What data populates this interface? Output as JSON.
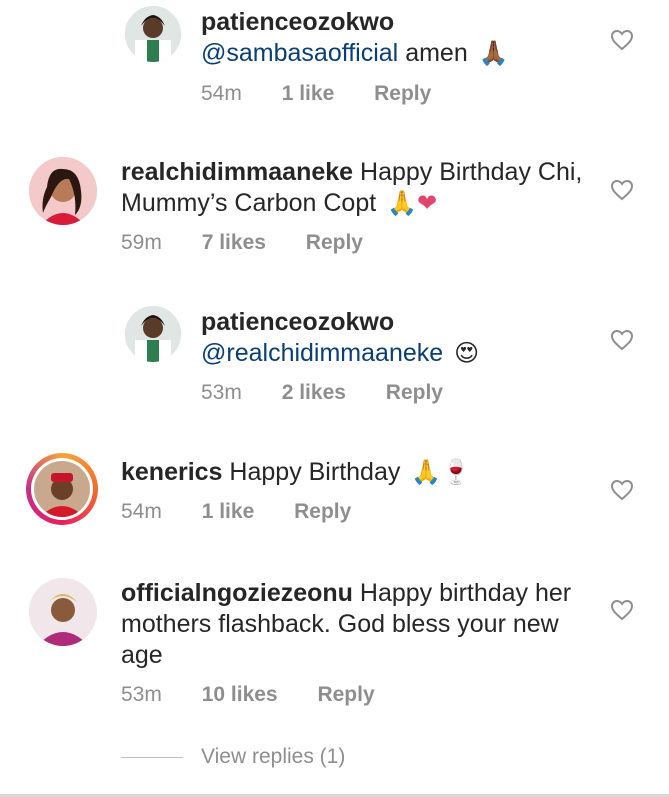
{
  "comments": [
    {
      "username": "patienceozokwo",
      "mention": "@sambasaofficial",
      "text": "amen",
      "emoji": "🙏🏾",
      "time": "54m",
      "likes": "1 like",
      "reply": "Reply"
    },
    {
      "username": "realchidimmaaneke",
      "text": "Happy Birthday Chi, Mummy’s  Carbon Copt",
      "emoji": "🙏❤",
      "time": "59m",
      "likes": "7 likes",
      "reply": "Reply"
    },
    {
      "username": "patienceozokwo",
      "mention": "@realchidimmaaneke",
      "emoji": "😍",
      "time": "53m",
      "likes": "2 likes",
      "reply": "Reply"
    },
    {
      "username": "kenerics",
      "text": "Happy Birthday",
      "emoji": "🙏🍷",
      "time": "54m",
      "likes": "1 like",
      "reply": "Reply"
    },
    {
      "username": "officialngoziezeonu",
      "text": "Happy birthday her mothers flashback. God bless your new age",
      "time": "53m",
      "likes": "10 likes",
      "reply": "Reply"
    }
  ],
  "view_replies": "View replies (1)",
  "colors": {
    "mention": "#0a3e74",
    "meta": "#8e8e8e",
    "text": "#262626"
  },
  "icons": {
    "like": "heart-outline-icon"
  }
}
